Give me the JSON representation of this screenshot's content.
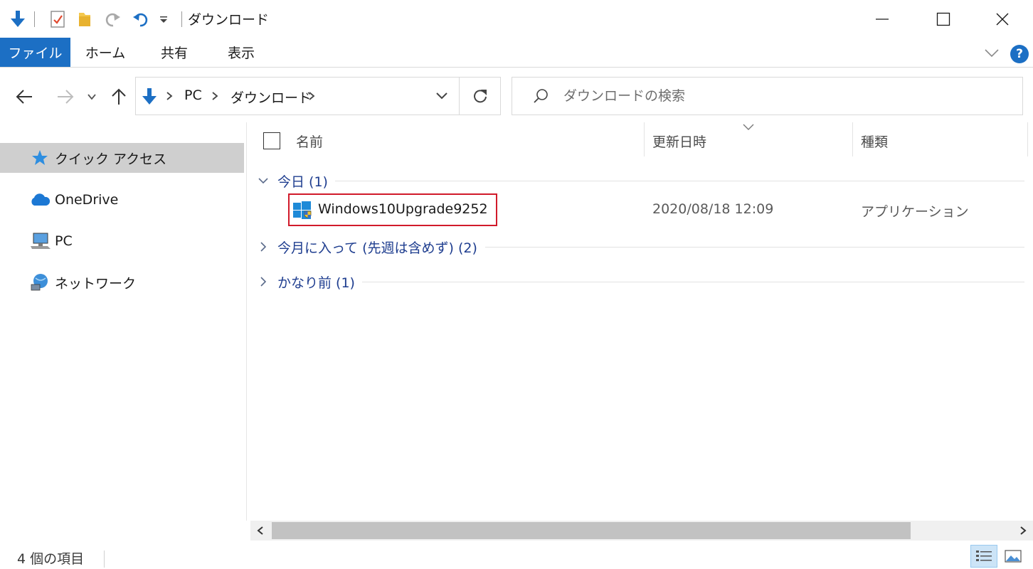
{
  "window": {
    "title": "ダウンロード"
  },
  "ribbon": {
    "tabs": [
      {
        "label": "ファイル"
      },
      {
        "label": "ホーム"
      },
      {
        "label": "共有"
      },
      {
        "label": "表示"
      }
    ],
    "help_label": "?"
  },
  "address": {
    "crumbs": [
      "PC",
      "ダウンロード"
    ]
  },
  "search": {
    "placeholder": "ダウンロードの検索"
  },
  "sidebar": {
    "items": [
      {
        "label": "クイック アクセス",
        "icon": "star-icon"
      },
      {
        "label": "OneDrive",
        "icon": "cloud-icon"
      },
      {
        "label": "PC",
        "icon": "computer-icon"
      },
      {
        "label": "ネットワーク",
        "icon": "network-icon"
      }
    ]
  },
  "content": {
    "columns": [
      {
        "label": "名前"
      },
      {
        "label": "更新日時"
      },
      {
        "label": "種類"
      }
    ],
    "groups": [
      {
        "label": "今日 (1)",
        "expanded": true
      },
      {
        "label": "今月に入って (先週は含めず) (2)",
        "expanded": false
      },
      {
        "label": "かなり前 (1)",
        "expanded": false
      }
    ],
    "files": [
      {
        "name": "Windows10Upgrade9252",
        "date": "2020/08/18 12:09",
        "type": "アプリケーション"
      }
    ]
  },
  "status": {
    "item_count": "4 個の項目"
  },
  "colors": {
    "accent": "#1c6fc4",
    "group_text": "#1e3d8f",
    "highlight_border": "#d11a2a",
    "selected_nav": "#cfcfcf"
  }
}
